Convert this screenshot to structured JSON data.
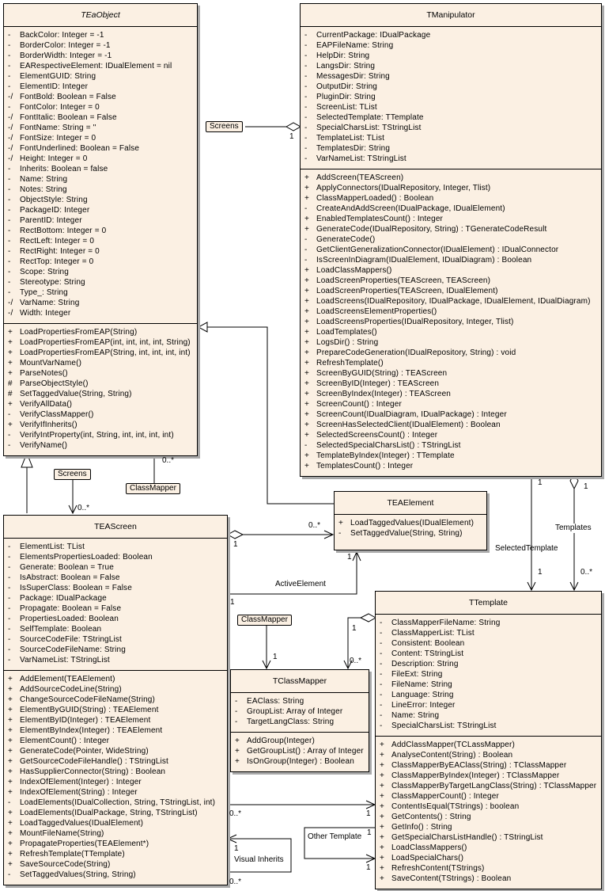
{
  "classes": {
    "teaobject": {
      "name": "TEaObject",
      "attributes": [
        {
          "vis": "-",
          "text": "BackColor:  Integer = -1"
        },
        {
          "vis": "-",
          "text": "BorderColor:  Integer = -1"
        },
        {
          "vis": "-",
          "text": "BorderWidth:  Integer = -1"
        },
        {
          "vis": "-",
          "text": "EARespectiveElement:  IDualElement = nil"
        },
        {
          "vis": "-",
          "text": "ElementGUID:  String"
        },
        {
          "vis": "-",
          "text": "ElementID:  Integer"
        },
        {
          "vis": "-/",
          "text": "FontBold:  Boolean = False"
        },
        {
          "vis": "-",
          "text": "FontColor:  Integer = 0"
        },
        {
          "vis": "-/",
          "text": "FontItalic:  Boolean = False"
        },
        {
          "vis": "-/",
          "text": "FontName:  String = ''"
        },
        {
          "vis": "-/",
          "text": "FontSize:  Integer = 0"
        },
        {
          "vis": "-/",
          "text": "FontUnderlined:  Boolean = False"
        },
        {
          "vis": "-/",
          "text": "Height:  Integer = 0"
        },
        {
          "vis": "-",
          "text": "Inherits:  Boolean = false"
        },
        {
          "vis": "-",
          "text": "Name:  String"
        },
        {
          "vis": "-",
          "text": "Notes:  String"
        },
        {
          "vis": "-",
          "text": "ObjectStyle:  String"
        },
        {
          "vis": "-",
          "text": "PackageID:  Integer"
        },
        {
          "vis": "-",
          "text": "ParentID:  Integer"
        },
        {
          "vis": "-",
          "text": "RectBottom:  Integer = 0"
        },
        {
          "vis": "-",
          "text": "RectLeft:  Integer = 0"
        },
        {
          "vis": "-",
          "text": "RectRight:  Integer = 0"
        },
        {
          "vis": "-",
          "text": "RectTop:  Integer = 0"
        },
        {
          "vis": "-",
          "text": "Scope:  String"
        },
        {
          "vis": "-",
          "text": "Stereotype:  String"
        },
        {
          "vis": "-",
          "text": "Type_:  String"
        },
        {
          "vis": "-/",
          "text": "VarName:  String"
        },
        {
          "vis": "-/",
          "text": "Width:  Integer"
        }
      ],
      "operations": [
        {
          "vis": "+",
          "text": "LoadPropertiesFromEAP(String)"
        },
        {
          "vis": "+",
          "text": "LoadPropertiesFromEAP(int, int, int, int, String)"
        },
        {
          "vis": "+",
          "text": "LoadPropertiesFromEAP(String, int, int, int, int)"
        },
        {
          "vis": "+",
          "text": "MountVarName()"
        },
        {
          "vis": "+",
          "text": "ParseNotes()"
        },
        {
          "vis": "#",
          "text": "ParseObjectStyle()"
        },
        {
          "vis": "#",
          "text": "SetTaggedValue(String, String)"
        },
        {
          "vis": "+",
          "text": "VerifyAllData()"
        },
        {
          "vis": "-",
          "text": "VerifyClassMapper()"
        },
        {
          "vis": "+",
          "text": "VerifyIfInherits()"
        },
        {
          "vis": "-",
          "text": "VerifyIntProperty(int, String, int, int, int, int)"
        },
        {
          "vis": "-",
          "text": "VerifyName()"
        }
      ]
    },
    "tmanipulator": {
      "name": "TManipulator",
      "attributes": [
        {
          "vis": "-",
          "text": "CurrentPackage:  IDualPackage"
        },
        {
          "vis": "-",
          "text": "EAPFileName:  String"
        },
        {
          "vis": "-",
          "text": "HelpDir:  String"
        },
        {
          "vis": "-",
          "text": "LangsDir:  String"
        },
        {
          "vis": "-",
          "text": "MessagesDir:  String"
        },
        {
          "vis": "-",
          "text": "OutputDir:  String"
        },
        {
          "vis": "-",
          "text": "PluginDir:  String"
        },
        {
          "vis": "-",
          "text": "ScreenList:  TList"
        },
        {
          "vis": "-",
          "text": "SelectedTemplate:  TTemplate"
        },
        {
          "vis": "-",
          "text": "SpecialCharsList:  TStringList"
        },
        {
          "vis": "-",
          "text": "TemplateList:  TList"
        },
        {
          "vis": "-",
          "text": "TemplatesDir:  String"
        },
        {
          "vis": "-",
          "text": "VarNameList:  TStringList"
        }
      ],
      "operations": [
        {
          "vis": "+",
          "text": "AddScreen(TEAScreen)"
        },
        {
          "vis": "+",
          "text": "ApplyConnectors(IDualRepository, Integer, Tlist)"
        },
        {
          "vis": "+",
          "text": "ClassMapperLoaded() : Boolean"
        },
        {
          "vis": "-",
          "text": "CreateAndAddScreen(IDualPackage, IDualElement)"
        },
        {
          "vis": "+",
          "text": "EnabledTemplatesCount() : Integer"
        },
        {
          "vis": "+",
          "text": "GenerateCode(IDualRepository, String) : TGenerateCodeResult"
        },
        {
          "vis": "-",
          "text": "GenerateCode()"
        },
        {
          "vis": "-",
          "text": "GetClientGeneralizationConnector(IDualElement) : IDualConnector"
        },
        {
          "vis": "-",
          "text": "IsScreenInDiagram(IDualElement, IDualDiagram) : Boolean"
        },
        {
          "vis": "+",
          "text": "LoadClassMappers()"
        },
        {
          "vis": "+",
          "text": "LoadScreenProperties(TEAScreen, TEAScreen)"
        },
        {
          "vis": "+",
          "text": "LoadScreenProperties(TEAScreen, IDualElement)"
        },
        {
          "vis": "+",
          "text": "LoadScreens(IDualRepository, IDualPackage, IDualElement, IDualDiagram)"
        },
        {
          "vis": "+",
          "text": "LoadScreensElementProperties()"
        },
        {
          "vis": "+",
          "text": "LoadScreensProperties(IDualRepository, Integer, Tlist)"
        },
        {
          "vis": "+",
          "text": "LoadTemplates()"
        },
        {
          "vis": "+",
          "text": "LogsDir() : String"
        },
        {
          "vis": "+",
          "text": "PrepareCodeGeneration(IDualRepository, String) : void"
        },
        {
          "vis": "+",
          "text": "RefreshTemplate()"
        },
        {
          "vis": "+",
          "text": "ScreenByGUID(String) : TEAScreen"
        },
        {
          "vis": "+",
          "text": "ScreenByID(Integer) : TEAScreen"
        },
        {
          "vis": "+",
          "text": "ScreenByIndex(Integer) : TEAScreen"
        },
        {
          "vis": "+",
          "text": "ScreenCount() : Integer"
        },
        {
          "vis": "+",
          "text": "ScreenCount(IDualDiagram, IDualPackage) : Integer"
        },
        {
          "vis": "+",
          "text": "ScreenHasSelectedClient(IDualElement) : Boolean"
        },
        {
          "vis": "+",
          "text": "SelectedScreensCount() : Integer"
        },
        {
          "vis": "-",
          "text": "SelectedSpecialCharsList() : TStringList"
        },
        {
          "vis": "+",
          "text": "TemplateByIndex(Integer) : TTemplate"
        },
        {
          "vis": "+",
          "text": "TemplatesCount() : Integer"
        }
      ]
    },
    "teaelement": {
      "name": "TEAElement",
      "operations": [
        {
          "vis": "+",
          "text": "LoadTaggedValues(IDualElement)"
        },
        {
          "vis": "-",
          "text": "SetTaggedValue(String, String)"
        }
      ]
    },
    "teascreen": {
      "name": "TEAScreen",
      "attributes": [
        {
          "vis": "-",
          "text": "ElementList:  TList"
        },
        {
          "vis": "-",
          "text": "ElementsPropertiesLoaded:  Boolean"
        },
        {
          "vis": "-",
          "text": "Generate:  Boolean = True"
        },
        {
          "vis": "-",
          "text": "IsAbstract:  Boolean = False"
        },
        {
          "vis": "-",
          "text": "IsSuperClass:  Boolean = False"
        },
        {
          "vis": "-",
          "text": "Package:  IDualPackage"
        },
        {
          "vis": "-",
          "text": "Propagate:  Boolean = False"
        },
        {
          "vis": "-",
          "text": "PropertiesLoaded:  Boolean"
        },
        {
          "vis": "-",
          "text": "SelfTemplate:  Boolean"
        },
        {
          "vis": "-",
          "text": "SourceCodeFile:  TStringList"
        },
        {
          "vis": "-",
          "text": "SourceCodeFileName:  String"
        },
        {
          "vis": "-",
          "text": "VarNameList:  TStringList"
        }
      ],
      "operations": [
        {
          "vis": "+",
          "text": "AddElement(TEAElement)"
        },
        {
          "vis": "+",
          "text": "AddSourceCodeLine(String)"
        },
        {
          "vis": "+",
          "text": "ChangeSourceCodeFileName(String)"
        },
        {
          "vis": "+",
          "text": "ElementByGUID(String) : TEAElement"
        },
        {
          "vis": "+",
          "text": "ElementByID(Integer) : TEAElement"
        },
        {
          "vis": "+",
          "text": "ElementByIndex(Integer) : TEAElement"
        },
        {
          "vis": "+",
          "text": "ElementCount() : Integer"
        },
        {
          "vis": "+",
          "text": "GenerateCode(Pointer, WideString)"
        },
        {
          "vis": "+",
          "text": "GetSourceCodeFileHandle() : TStringList"
        },
        {
          "vis": "+",
          "text": "HasSupplierConnector(String) : Boolean"
        },
        {
          "vis": "+",
          "text": "IndexOfElement(Integer) : Integer"
        },
        {
          "vis": "+",
          "text": "IndexOfElement(String) : Integer"
        },
        {
          "vis": "-",
          "text": "LoadElements(IDualCollection, String, TStringList, int)"
        },
        {
          "vis": "+",
          "text": "LoadElements(IDualPackage, String, TStringList)"
        },
        {
          "vis": "+",
          "text": "LoadTaggedValues(IDualElement)"
        },
        {
          "vis": "+",
          "text": "MountFileName(String)"
        },
        {
          "vis": "+",
          "text": "PropagateProperties(TEAElement*)"
        },
        {
          "vis": "+",
          "text": "RefreshTemplate(TTemplate)"
        },
        {
          "vis": "+",
          "text": "SaveSourceCode(String)"
        },
        {
          "vis": "-",
          "text": "SetTaggedValues(String, String)"
        }
      ]
    },
    "tclassmapper": {
      "name": "TClassMapper",
      "attributes": [
        {
          "vis": "-",
          "text": "EAClass:  String"
        },
        {
          "vis": "-",
          "text": "GroupList:  Array of Integer"
        },
        {
          "vis": "-",
          "text": "TargetLangClass:  String"
        }
      ],
      "operations": [
        {
          "vis": "+",
          "text": "AddGroup(Integer)"
        },
        {
          "vis": "+",
          "text": "GetGroupList() : Array of Integer"
        },
        {
          "vis": "+",
          "text": "IsOnGroup(Integer) : Boolean"
        }
      ]
    },
    "ttemplate": {
      "name": "TTemplate",
      "attributes": [
        {
          "vis": "-",
          "text": "ClassMapperFileName:  String"
        },
        {
          "vis": "-",
          "text": "ClassMapperList:  TList"
        },
        {
          "vis": "-",
          "text": "Consistent:  Boolean"
        },
        {
          "vis": "-",
          "text": "Content:  TStringList"
        },
        {
          "vis": "-",
          "text": "Description:  String"
        },
        {
          "vis": "-",
          "text": "FileExt:  String"
        },
        {
          "vis": "-",
          "text": "FileName:  String"
        },
        {
          "vis": "-",
          "text": "Language:  String"
        },
        {
          "vis": "-",
          "text": "LineError:  Integer"
        },
        {
          "vis": "-",
          "text": "Name:  String"
        },
        {
          "vis": "-",
          "text": "SpecialCharsList:  TStringList"
        }
      ],
      "operations": [
        {
          "vis": "+",
          "text": "AddClassMapper(TCLassMapper)"
        },
        {
          "vis": "+",
          "text": "AnalyseContent(String) : Boolean"
        },
        {
          "vis": "+",
          "text": "ClassMapperByEAClass(String) : TClassMapper"
        },
        {
          "vis": "+",
          "text": "ClassMapperByIndex(Integer) : TClassMapper"
        },
        {
          "vis": "+",
          "text": "ClassMapperByTargetLangClass(String) : TClassMapper"
        },
        {
          "vis": "+",
          "text": "ClassMapperCount() : Integer"
        },
        {
          "vis": "+",
          "text": "ContentIsEqual(TStrings) : boolean"
        },
        {
          "vis": "+",
          "text": "GetContents() : String"
        },
        {
          "vis": "+",
          "text": "GetInfo() : String"
        },
        {
          "vis": "+",
          "text": "GetSpecialCharsListHandle() : TStringList"
        },
        {
          "vis": "+",
          "text": "LoadClassMappers()"
        },
        {
          "vis": "+",
          "text": "LoadSpecialChars()"
        },
        {
          "vis": "+",
          "text": "RefreshContent(TStrings)"
        },
        {
          "vis": "+",
          "text": "SaveContent(TStrings) : Boolean"
        }
      ]
    }
  },
  "connector_tags": {
    "screens_top": "Screens",
    "screens_left": "Screens",
    "classmapper_top": "ClassMapper",
    "classmapper_mid": "ClassMapper"
  },
  "connector_labels": {
    "active_element": "ActiveElement",
    "selected_template": "SelectedTemplate",
    "templates": "Templates",
    "other_template": "Other Template",
    "visual_inherits": "Visual Inherits"
  },
  "multiplicities": {
    "manip_screens": "1",
    "teaobject_classmapper": "0..*",
    "teascreen_screens": "0..*",
    "teascreen_elem_agg": "1",
    "teaelement_elem": "0..*",
    "teaelement_active": "1",
    "teascreen_active": "1",
    "manip_selected": "1",
    "template_selected": "1",
    "manip_templates": "1",
    "template_templates": "0..*",
    "classmapper_tag": "1",
    "template_cm_agg": "1",
    "classmapper_list": "0..*",
    "teascreen_template": "0..*",
    "template_from_screen": "1",
    "other_template_src": "1",
    "other_template_dst": "1",
    "visual_inherits_src": "0..*",
    "visual_inherits_dst": "1"
  }
}
